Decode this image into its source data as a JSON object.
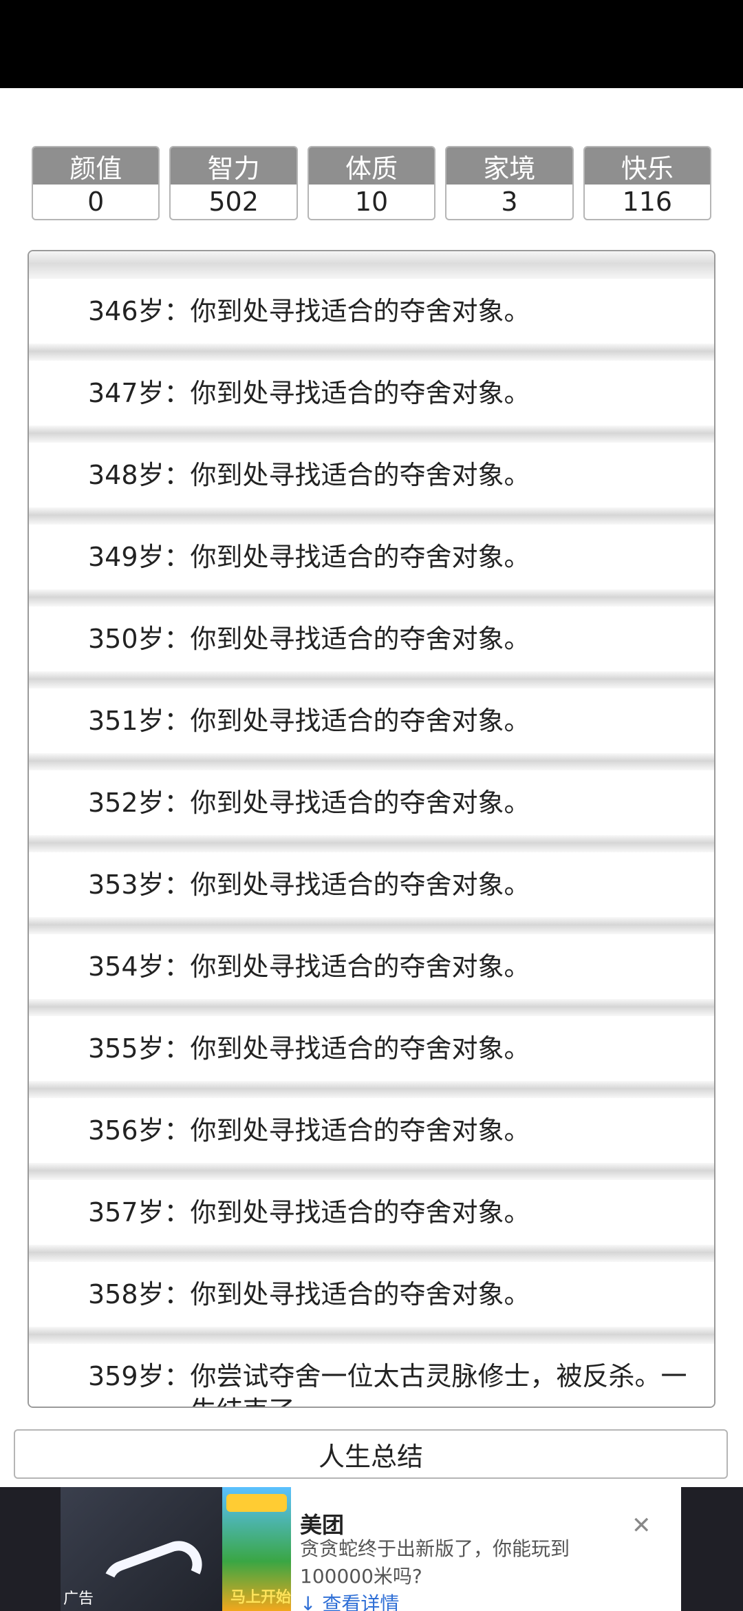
{
  "stats": [
    {
      "label": "颜值",
      "value": "0"
    },
    {
      "label": "智力",
      "value": "502"
    },
    {
      "label": "体质",
      "value": "10"
    },
    {
      "label": "家境",
      "value": "3"
    },
    {
      "label": "快乐",
      "value": "116"
    }
  ],
  "log": [
    {
      "age": "346岁：",
      "text": "你到处寻找适合的夺舍对象。"
    },
    {
      "age": "347岁：",
      "text": "你到处寻找适合的夺舍对象。"
    },
    {
      "age": "348岁：",
      "text": "你到处寻找适合的夺舍对象。"
    },
    {
      "age": "349岁：",
      "text": "你到处寻找适合的夺舍对象。"
    },
    {
      "age": "350岁：",
      "text": "你到处寻找适合的夺舍对象。"
    },
    {
      "age": "351岁：",
      "text": "你到处寻找适合的夺舍对象。"
    },
    {
      "age": "352岁：",
      "text": "你到处寻找适合的夺舍对象。"
    },
    {
      "age": "353岁：",
      "text": "你到处寻找适合的夺舍对象。"
    },
    {
      "age": "354岁：",
      "text": "你到处寻找适合的夺舍对象。"
    },
    {
      "age": "355岁：",
      "text": "你到处寻找适合的夺舍对象。"
    },
    {
      "age": "356岁：",
      "text": "你到处寻找适合的夺舍对象。"
    },
    {
      "age": "357岁：",
      "text": "你到处寻找适合的夺舍对象。"
    },
    {
      "age": "358岁：",
      "text": "你到处寻找适合的夺舍对象。"
    },
    {
      "age": "359岁：",
      "text": "你尝试夺舍一位太古灵脉修士，被反杀。一生结束了。"
    }
  ],
  "summary_button": "人生总结",
  "ad": {
    "label": "广告",
    "cover_button": "马上开始",
    "brand": "美团",
    "desc": "贪贪蛇终于出新版了，你能玩到100000米吗?",
    "link": "↓ 查看详情",
    "close": "✕"
  }
}
